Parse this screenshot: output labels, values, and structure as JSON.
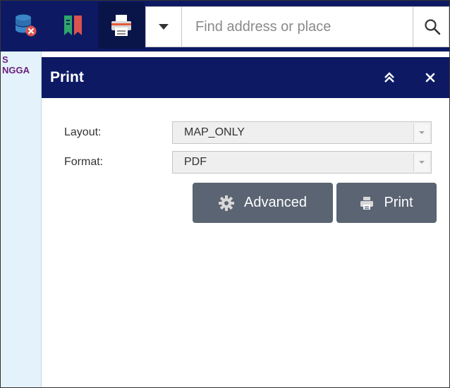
{
  "toolbar": {
    "buttons": [
      {
        "icon": "database-remove-icon",
        "active": false
      },
      {
        "icon": "bookmark-icon",
        "active": false
      },
      {
        "icon": "printer-icon",
        "active": true
      }
    ],
    "search": {
      "placeholder": "Find address or place",
      "dropdown_icon": "caret-down-icon",
      "search_icon": "search-icon"
    }
  },
  "map": {
    "label_lines": "S\nNGGA"
  },
  "panel": {
    "title": "Print",
    "collapse_icon": "double-chevron-up-icon",
    "close_icon": "close-icon",
    "fields": {
      "layout": {
        "label": "Layout:",
        "value": "MAP_ONLY"
      },
      "format": {
        "label": "Format:",
        "value": "PDF"
      }
    },
    "buttons": {
      "advanced": {
        "label": "Advanced",
        "icon": "gear-icon"
      },
      "print": {
        "label": "Print",
        "icon": "printer-icon"
      }
    }
  },
  "colors": {
    "header_bg": "#0d1a63",
    "button_bg": "#5a6472",
    "map_bg": "#e4f2fb"
  }
}
